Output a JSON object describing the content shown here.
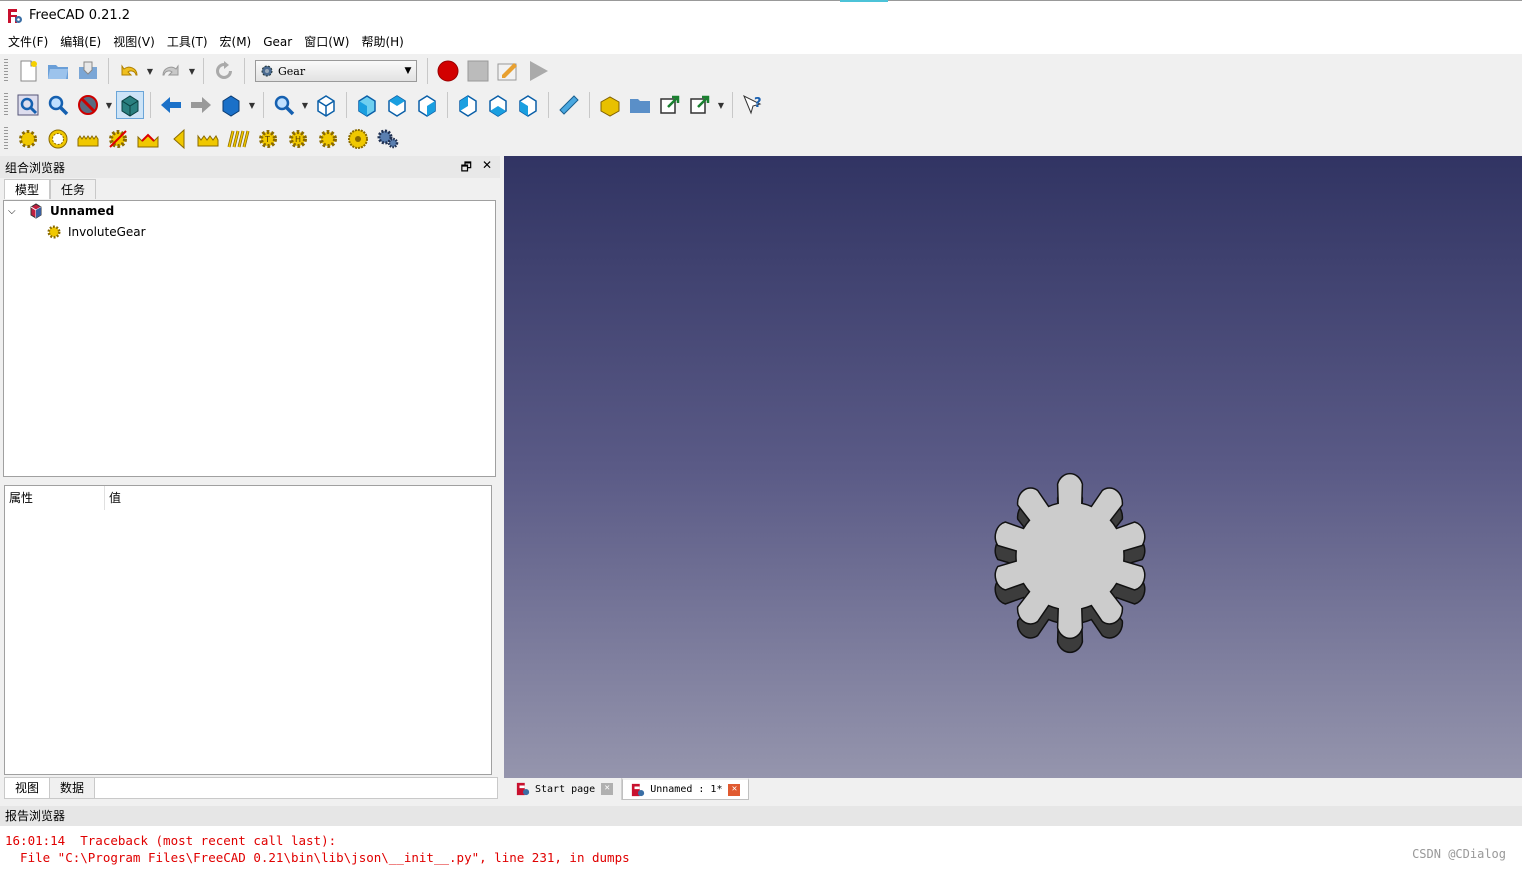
{
  "window": {
    "title": "FreeCAD 0.21.2"
  },
  "menu": [
    "文件(F)",
    "编辑(E)",
    "视图(V)",
    "工具(T)",
    "宏(M)",
    "Gear",
    "窗口(W)",
    "帮助(H)"
  ],
  "workbench": {
    "selected": "Gear"
  },
  "combo_view": {
    "title": "组合浏览器",
    "tabs": [
      "模型",
      "任务"
    ],
    "tree": {
      "root": "Unnamed",
      "child": "InvoluteGear"
    },
    "property_headers": [
      "属性",
      "值"
    ],
    "bottom_tabs": [
      "视图",
      "数据"
    ]
  },
  "doc_tabs": [
    {
      "label": "Start page",
      "active": false
    },
    {
      "label": "Unnamed : 1*",
      "active": true
    }
  ],
  "report": {
    "title": "报告浏览器",
    "line1": "16:01:14  Traceback (most recent call last):",
    "line2": "  File \"C:\\Program Files\\FreeCAD 0.21\\bin\\lib\\json\\__init__.py\", line 231, in dumps"
  },
  "watermark": "CSDN @CDialog",
  "colors": {
    "viewport_top": "#313463",
    "viewport_bottom": "#9595ad",
    "gear_face": "#cccccc",
    "gear_side": "#3c3c3c",
    "error_text": "#e00000"
  }
}
